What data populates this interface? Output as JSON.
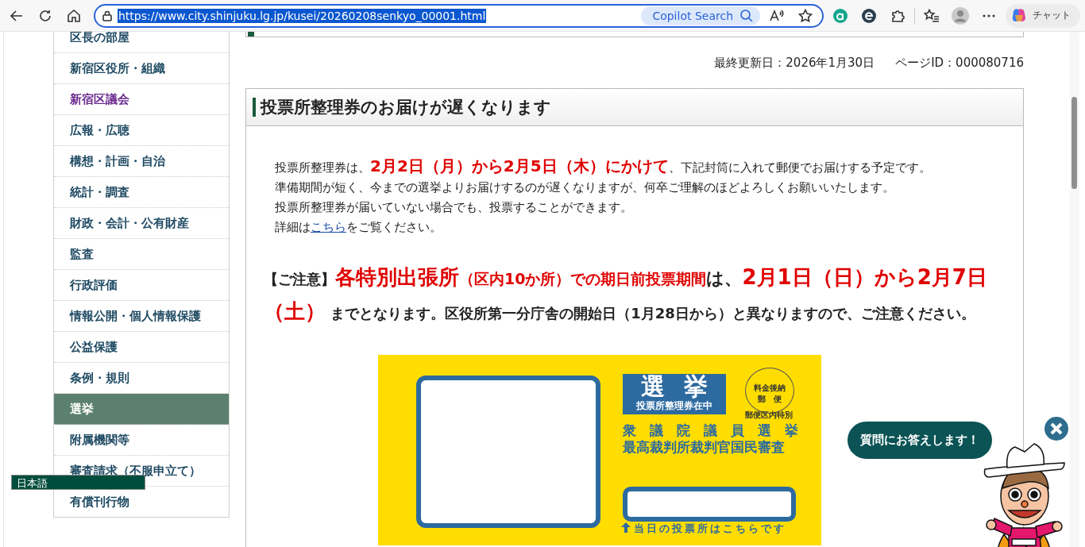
{
  "browser": {
    "url": "https://www.city.shinjuku.lg.jp/kusei/20260208senkyo_00001.html",
    "search_label": "Copilot Search",
    "chat_label": "チャット"
  },
  "sidebar": {
    "items": [
      {
        "label": "区長の部屋",
        "selected": false,
        "visited": false
      },
      {
        "label": "新宿区役所・組織",
        "selected": false,
        "visited": false
      },
      {
        "label": "新宿区議会",
        "selected": false,
        "visited": true
      },
      {
        "label": "広報・広聴",
        "selected": false,
        "visited": false
      },
      {
        "label": "構想・計画・自治",
        "selected": false,
        "visited": false
      },
      {
        "label": "統計・調査",
        "selected": false,
        "visited": false
      },
      {
        "label": "財政・会計・公有財産",
        "selected": false,
        "visited": false
      },
      {
        "label": "監査",
        "selected": false,
        "visited": false
      },
      {
        "label": "行政評価",
        "selected": false,
        "visited": false
      },
      {
        "label": "情報公開・個人情報保護",
        "selected": false,
        "visited": false
      },
      {
        "label": "公益保護",
        "selected": false,
        "visited": false
      },
      {
        "label": "条例・規則",
        "selected": false,
        "visited": false
      },
      {
        "label": "選挙",
        "selected": true,
        "visited": false
      },
      {
        "label": "附属機関等",
        "selected": false,
        "visited": false
      },
      {
        "label": "審査請求（不服申立て）",
        "selected": false,
        "visited": false
      },
      {
        "label": "有償刊行物",
        "selected": false,
        "visited": false
      }
    ]
  },
  "language_selector": {
    "label": "日本語"
  },
  "article": {
    "last_updated": "最終更新日：2026年1月30日",
    "page_id": "ページID：000080716",
    "title": "投票所整理券のお届けが遅くなります",
    "paragraphs": [
      "投票所整理券は、**2月2日（月）から2月5日（木）にかけて**、下記封筒に入れて郵便でお届けする予定です。",
      "準備期間が短く、今までの選挙よりお届けするのが遅くなりますが、何卒ご理解のほどよろしくお願いいたします。",
      "投票所整理券が届いていない場合でも、投票することができます。"
    ],
    "detail": {
      "before": "詳細は",
      "link": "こちら",
      "after": "をご覧ください。"
    },
    "notice": [
      {
        "kind": "plain",
        "text": "【ご注意】"
      },
      {
        "kind": "red-large",
        "text": "各特別出張所"
      },
      {
        "kind": "red",
        "text": "（区内10か所）での期日前投票期間"
      },
      {
        "kind": "plain-large",
        "text": "は、"
      },
      {
        "kind": "red-large",
        "text": "2月1日（日）から2月7日（土）"
      },
      {
        "kind": "plain",
        "text": " までとなります。区役所第一分庁舎の開始日（1月28日から）と異なりますので、ご注意ください。"
      }
    ],
    "envelope": {
      "title": "選挙",
      "enclosure": "投票所整理券在中",
      "postage": [
        "料金後納",
        "郵　便"
      ],
      "postal_note": "郵便区内特別",
      "election_lines": [
        "衆　議　院　議　員　選　挙",
        "最高裁判所裁判官国民審査"
      ],
      "address_caption": "当日の投票所はこちらです"
    }
  },
  "chat_widget": {
    "bubble": "質問にお答えします！"
  }
}
